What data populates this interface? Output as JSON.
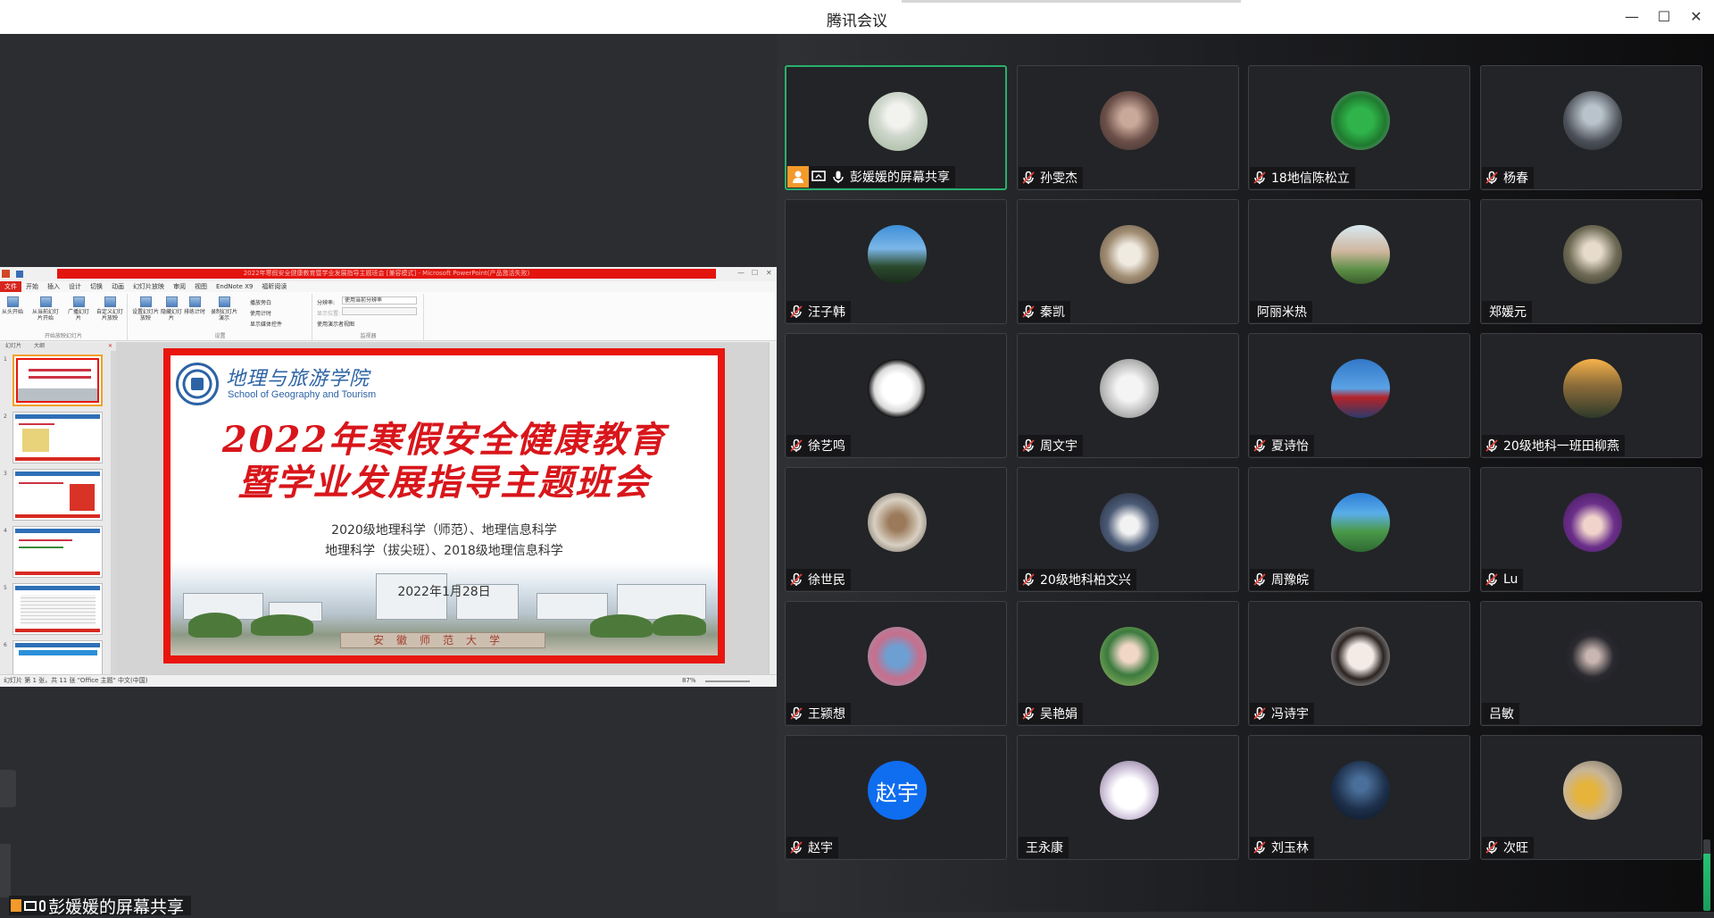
{
  "window": {
    "title": "腾讯会议",
    "minimize_glyph": "—",
    "maximize_glyph": "☐",
    "close_glyph": "✕"
  },
  "share": {
    "presenter_label": "彭媛媛的屏幕共享",
    "ppt": {
      "title_bar": "2022年寒假安全健康教育暨学业发展指导主题班会 [兼容模式] - Microsoft PowerPoint(产品激活失败)",
      "tabs": [
        "文件",
        "开始",
        "插入",
        "设计",
        "切换",
        "动画",
        "幻灯片放映",
        "审阅",
        "视图",
        "EndNote X9",
        "福昕阅读"
      ],
      "ribbon_buttons": [
        "从头开始",
        "从当前幻灯片开始",
        "广播幻灯片",
        "自定义幻灯片放映",
        "设置幻灯片放映",
        "隐藏幻灯片",
        "排练计时",
        "录制幻灯片演示"
      ],
      "ribbon_checks": [
        "播放旁白",
        "使用计时",
        "显示媒体控件"
      ],
      "resolution_label": "分辨率:",
      "resolution_value": "使用当前分辨率",
      "show_on_label": "显示位置:",
      "presenter_view": "使用演示者视图",
      "groups": [
        "开始放映幻灯片",
        "设置",
        "监视器"
      ],
      "pane_tabs": [
        "幻灯片",
        "大纲"
      ],
      "status": "幻灯片 第 1 张，共 11 张    \"Office 主题\"    中文(中国)",
      "zoom": "87%",
      "slide": {
        "school_cn": "地理与旅游学院",
        "school_en": "School of Geography and Tourism",
        "title_line1": "2022年寒假安全健康教育",
        "title_line2": "暨学业发展指导主题班会",
        "sub_line1": "2020级地理科学（师范）、地理信息科学",
        "sub_line2": "地理科学（拔尖班）、2018级地理信息科学",
        "date": "2022年1月28日",
        "gate_text": "安徽师范大学"
      }
    }
  },
  "participants": [
    {
      "name": "彭媛媛的屏幕共享",
      "muted": false,
      "host": true,
      "sharing": true,
      "active": true,
      "avatar": "photo-white-dress"
    },
    {
      "name": "孙雯杰",
      "muted": true,
      "avatar": "photo-anime"
    },
    {
      "name": "18地信陈松立",
      "muted": true,
      "avatar": "photo-green-monster"
    },
    {
      "name": "杨春",
      "muted": true,
      "avatar": "photo-person"
    },
    {
      "name": "汪子韩",
      "muted": true,
      "avatar": "photo-mountain"
    },
    {
      "name": "秦凯",
      "muted": true,
      "avatar": "photo-dog"
    },
    {
      "name": "阿丽米热",
      "muted": null,
      "avatar": "photo-girl-field"
    },
    {
      "name": "郑媛元",
      "muted": null,
      "avatar": "photo-helmet"
    },
    {
      "name": "徐艺鸣",
      "muted": true,
      "avatar": "photo-sketch"
    },
    {
      "name": "周文宇",
      "muted": true,
      "avatar": "photo-meme"
    },
    {
      "name": "夏诗怡",
      "muted": true,
      "avatar": "photo-blue-sky"
    },
    {
      "name": "20级地科一班田柳燕",
      "muted": true,
      "avatar": "photo-sunset"
    },
    {
      "name": "徐世民",
      "muted": true,
      "avatar": "photo-cat"
    },
    {
      "name": "20级地科柏文兴",
      "muted": true,
      "avatar": "photo-anime-boy"
    },
    {
      "name": "周豫皖",
      "muted": true,
      "avatar": "photo-city"
    },
    {
      "name": "Lu",
      "muted": true,
      "avatar": "photo-purple-anime"
    },
    {
      "name": "王颍想",
      "muted": true,
      "avatar": "photo-stitch"
    },
    {
      "name": "吴艳娟",
      "muted": true,
      "avatar": "photo-girl-leaves"
    },
    {
      "name": "冯诗宇",
      "muted": true,
      "avatar": "photo-girl-face"
    },
    {
      "name": "吕敏",
      "muted": null,
      "avatar": "photo-dark-hair"
    },
    {
      "name": "赵宇",
      "muted": true,
      "avatar_text": "赵宇"
    },
    {
      "name": "王永康",
      "muted": null,
      "avatar": "photo-anime-girl"
    },
    {
      "name": "刘玉林",
      "muted": true,
      "avatar": "photo-night"
    },
    {
      "name": "次旺",
      "muted": true,
      "avatar": "photo-yellow-hat"
    }
  ],
  "colors": {
    "active_border": "#29b06e",
    "host_badge": "#f39a2b",
    "text_avatar": "#0f6df0",
    "slide_red": "#e8160f"
  }
}
